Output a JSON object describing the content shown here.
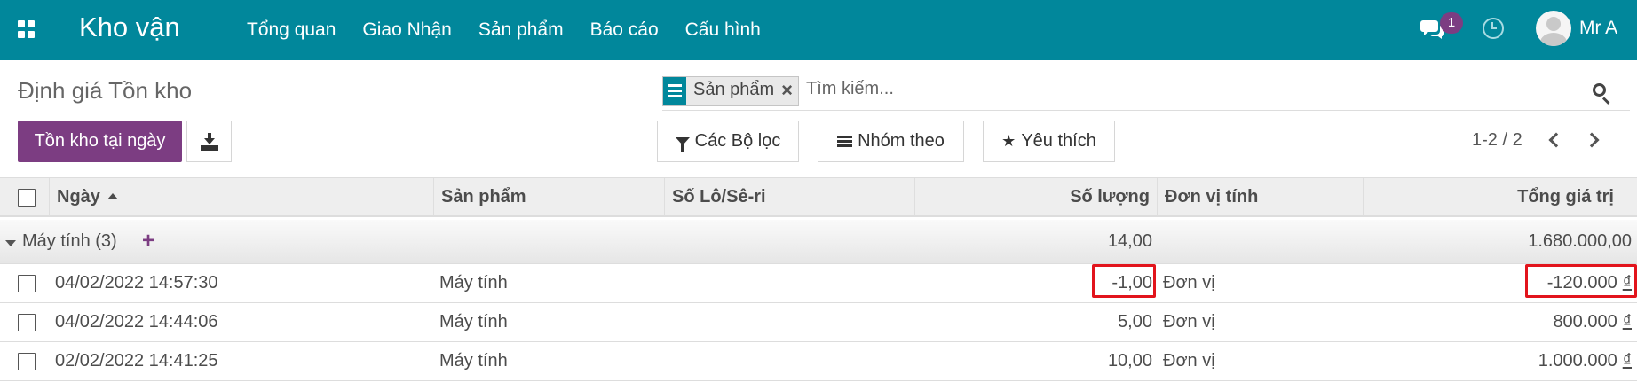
{
  "navbar": {
    "app_title": "Kho vận",
    "menu": [
      "Tổng quan",
      "Giao Nhận",
      "Sản phẩm",
      "Báo cáo",
      "Cấu hình"
    ],
    "message_count": "1",
    "user_name": "Mr A",
    "icons": [
      "apps-grid-icon",
      "chat-icon",
      "clock-icon",
      "avatar"
    ]
  },
  "control_panel": {
    "breadcrumb": "Định giá Tồn kho",
    "search": {
      "facet_label": "Sản phẩm",
      "placeholder": "Tìm kiếm..."
    },
    "primary_button": "Tồn kho tại ngày",
    "filters_label": "Các Bộ lọc",
    "groupby_label": "Nhóm theo",
    "favorites_label": "Yêu thích",
    "pager": "1-2 / 2"
  },
  "table": {
    "columns": [
      "Ngày",
      "Sản phẩm",
      "Số Lô/Sê-ri",
      "Số lượng",
      "Đơn vị tính",
      "Tổng giá trị"
    ],
    "group": {
      "label": "Máy tính (3)",
      "quantity": "14,00",
      "total": "1.680.000,00"
    },
    "rows": [
      {
        "date": "04/02/2022 14:57:30",
        "product": "Máy tính",
        "lot": "",
        "quantity": "-1,00",
        "uom": "Đơn vị",
        "value": "-120.000",
        "currency": "₫"
      },
      {
        "date": "04/02/2022 14:44:06",
        "product": "Máy tính",
        "lot": "",
        "quantity": "5,00",
        "uom": "Đơn vị",
        "value": "800.000",
        "currency": "₫"
      },
      {
        "date": "02/02/2022 14:41:25",
        "product": "Máy tính",
        "lot": "",
        "quantity": "10,00",
        "uom": "Đơn vị",
        "value": "1.000.000",
        "currency": "₫"
      }
    ]
  },
  "colors": {
    "navbar": "#01879b",
    "primary": "#7c3d82",
    "highlight": "#e2141c"
  }
}
